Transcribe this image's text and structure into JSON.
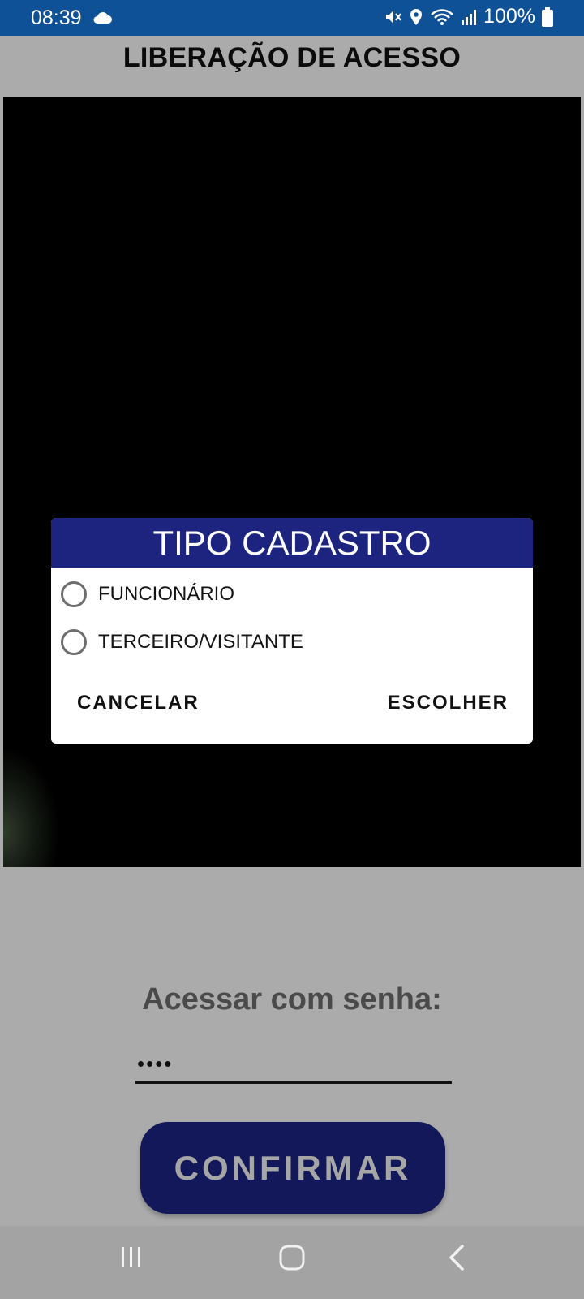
{
  "status_bar": {
    "time": "08:39",
    "battery": "100%",
    "icons": [
      "cloud-icon",
      "mute-icon",
      "location-icon",
      "wifi-icon",
      "signal-icon",
      "battery-icon"
    ]
  },
  "page": {
    "title": "LIBERAÇÃO DE ACESSO"
  },
  "dialog": {
    "title": "TIPO CADASTRO",
    "options": [
      {
        "label": "FUNCIONÁRIO",
        "selected": false
      },
      {
        "label": "TERCEIRO/VISITANTE",
        "selected": false
      }
    ],
    "cancel_label": "CANCELAR",
    "choose_label": "ESCOLHER"
  },
  "password": {
    "label": "Acessar com senha:",
    "value": "••••"
  },
  "confirm_label": "CONFIRMAR",
  "nav_bar": {
    "icons": [
      "recent-apps-icon",
      "home-icon",
      "back-icon"
    ]
  },
  "colors": {
    "status_bar": "#0f5196",
    "dialog_header": "#1c247f",
    "confirm_button": "#13185a",
    "background": "#ababab"
  }
}
